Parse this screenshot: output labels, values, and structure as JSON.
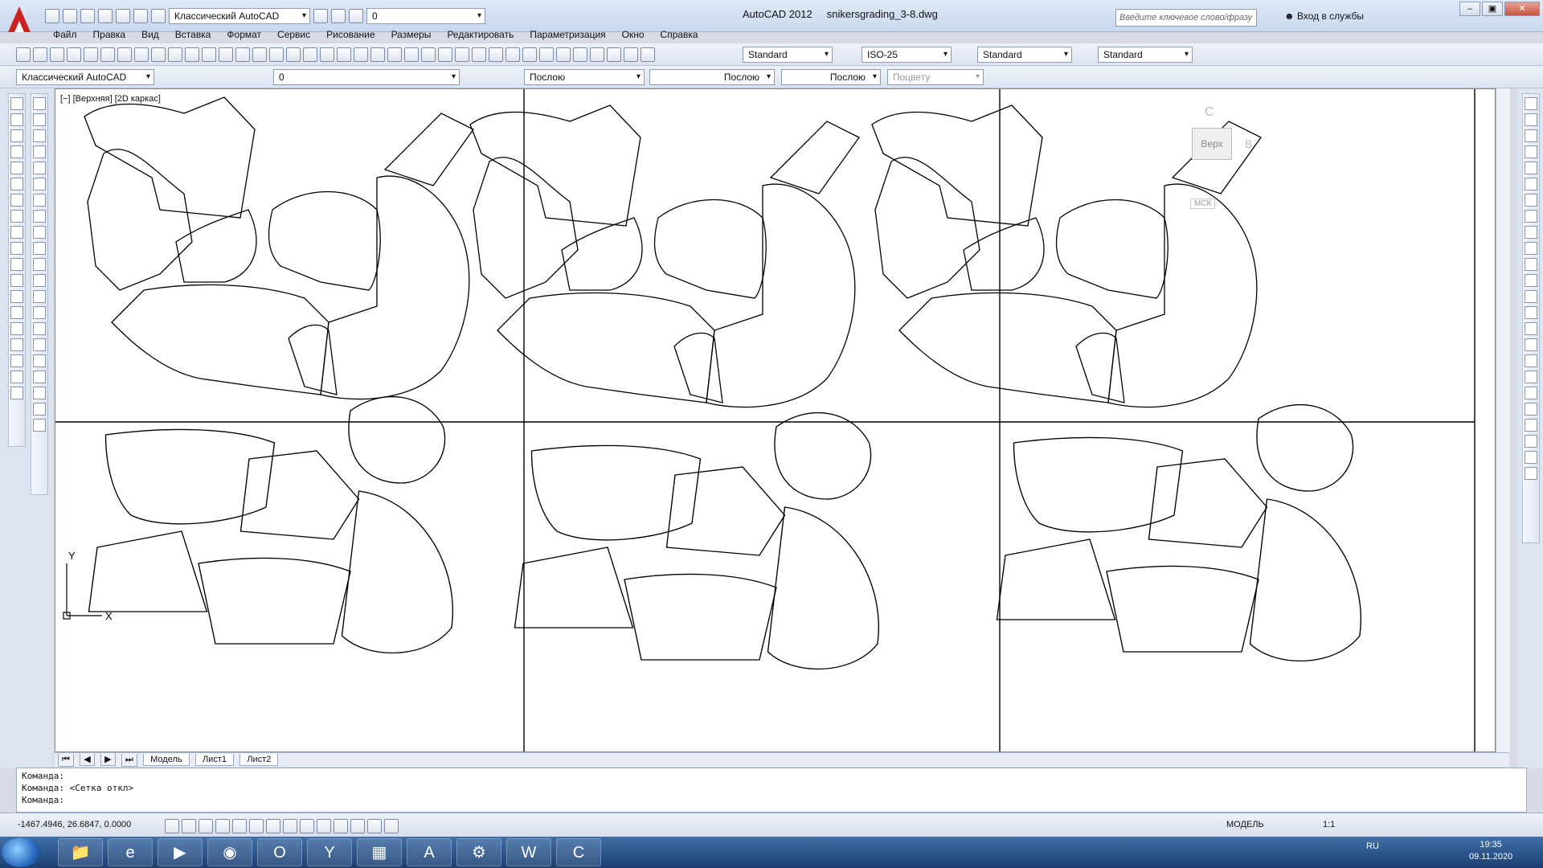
{
  "app": {
    "name": "AutoCAD 2012",
    "file": "snikersgrading_3-8.dwg",
    "workspace": "Классический AutoCAD",
    "layer_current": "0",
    "search_placeholder": "Введите ключевое слово/фразу",
    "signin_label": "Вход в службы"
  },
  "menu": [
    "Файл",
    "Правка",
    "Вид",
    "Вставка",
    "Формат",
    "Сервис",
    "Рисование",
    "Размеры",
    "Редактировать",
    "Параметризация",
    "Окно",
    "Справка"
  ],
  "styles_toolbar": {
    "text_style": "Standard",
    "dim_style": "ISO-25",
    "table_style": "Standard",
    "mleader_style": "Standard"
  },
  "props_toolbar": {
    "workspace": "Классический AutoCAD",
    "layer": "0",
    "color": "Послою",
    "linetype": "Послою",
    "lineweight": "Послою",
    "plotstyle": "Поцвету"
  },
  "viewport": {
    "label": "[−] [Верхняя] [2D каркас]",
    "viewcube_top": "Верх",
    "viewcube_n": "С",
    "viewcube_e": "В",
    "ucs": "МСК",
    "ucs_x": "X",
    "ucs_y": "Y"
  },
  "tabs": [
    "Модель",
    "Лист1",
    "Лист2"
  ],
  "command_lines": [
    "Команда:",
    "Команда:  <Сетка откл>",
    "Команда:"
  ],
  "status": {
    "coords": "-1467.4946, 26.6847, 0.0000",
    "model": "МОДЕЛЬ",
    "scale": "1:1"
  },
  "taskbar": {
    "lang": "RU",
    "time": "19:35",
    "date": "09.11.2020"
  }
}
